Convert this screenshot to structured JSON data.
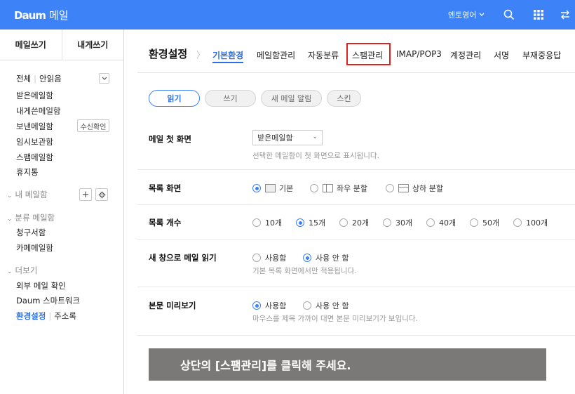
{
  "topbar": {
    "logo_mark": "Daum",
    "logo_text": "메일",
    "lang_label": "엔토영어",
    "accent": "#3e82f7"
  },
  "sidebar": {
    "compose": "메일쓰기",
    "self_compose": "내게쓰기",
    "all": "전체",
    "unread": "안읽음",
    "folders": [
      "받은메일함",
      "내게쓴메일함",
      "보낸메일함",
      "임시보관함",
      "스팸메일함",
      "휴지통"
    ],
    "receipt_button": "수신확인",
    "my_mailbox": "내 메일함",
    "classify": "분류 메일함",
    "classify_items": [
      "청구서함",
      "카페메일함"
    ],
    "more": "더보기",
    "more_items": [
      "외부 메일 확인",
      "Daum 스마트워크"
    ],
    "settings": "환경설정",
    "addressbook": "주소록"
  },
  "main": {
    "title": "환경설정",
    "tabs": [
      "기본환경",
      "메일함관리",
      "자동분류",
      "스팸관리",
      "IMAP/POP3",
      "계정관리",
      "서명",
      "부재중응답"
    ],
    "subtabs": [
      "읽기",
      "쓰기",
      "새 메일 알림",
      "스킨"
    ],
    "first_screen": {
      "label": "메일 첫 화면",
      "value": "받은메일함",
      "desc": "선택한 메일함이 첫 화면으로 표시됩니다."
    },
    "list_screen": {
      "label": "목록 화면",
      "options": [
        "기본",
        "좌우 분할",
        "상하 분할"
      ],
      "selected": "기본"
    },
    "list_count": {
      "label": "목록 개수",
      "options": [
        "10개",
        "15개",
        "20개",
        "30개",
        "40개",
        "50개",
        "100개"
      ],
      "selected": "15개"
    },
    "new_window": {
      "label": "새 창으로 메일 읽기",
      "options": [
        "사용함",
        "사용 안 함"
      ],
      "selected": "사용 안 함",
      "desc": "기본 목록 화면에서만 적용됩니다."
    },
    "preview": {
      "label": "본문 미리보기",
      "options": [
        "사용함",
        "사용 안 함"
      ],
      "selected": "사용함",
      "desc": "마우스를 제목 가까이 대면 본문 미리보기가 보입니다."
    }
  },
  "banner": {
    "text": "상단의 [스팸관리]를 클릭해 주세요."
  }
}
